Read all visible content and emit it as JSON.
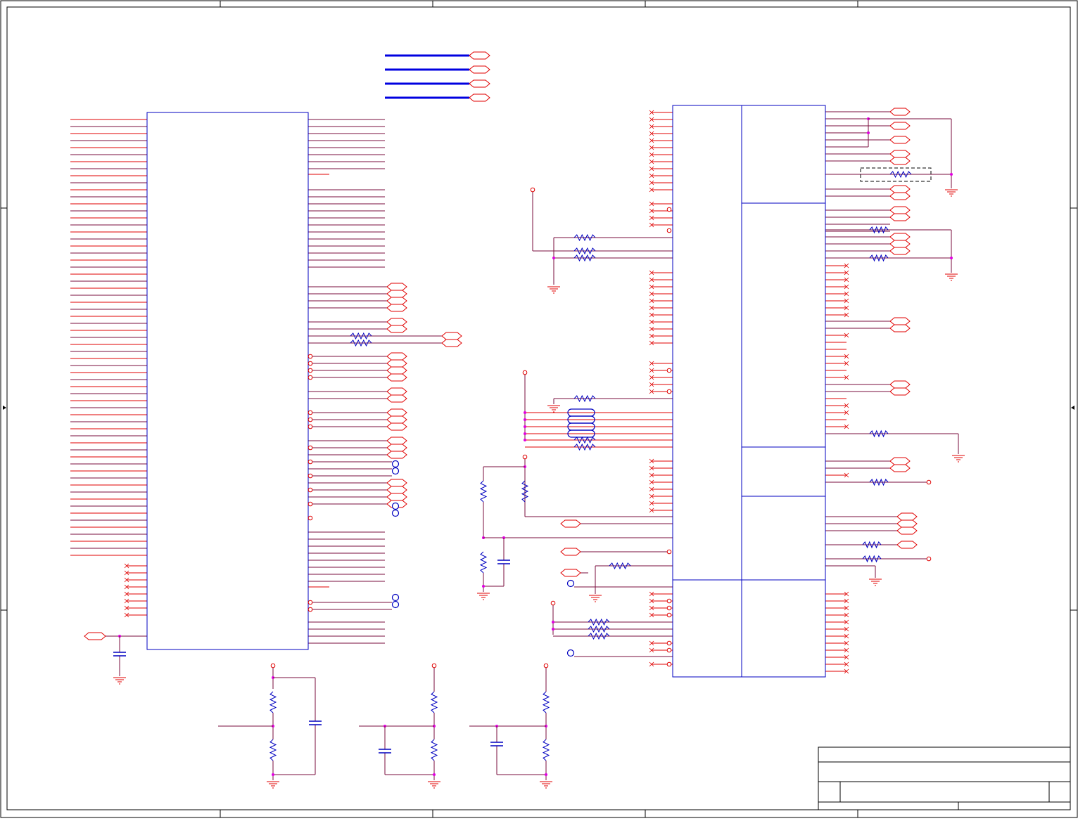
{
  "title_block": {
    "title": "",
    "document_number": "",
    "revision": "",
    "size": "",
    "date": "",
    "sheet": ""
  },
  "colors": {
    "frame": "#000000",
    "wire": "#7a0c3c",
    "pin": "#e00000",
    "symbol": "#0000c0",
    "bus": "#0000e0",
    "junction": "#e000e0"
  },
  "icons": {
    "port": "hexagon-port-icon",
    "ground": "ground-icon",
    "resistor": "resistor-icon",
    "capacitor": "capacitor-icon",
    "no_connect": "no-connect-icon",
    "test_point": "test-point-icon",
    "power": "power-pin-icon"
  },
  "components": [
    {
      "id": "u-main-processor",
      "kind": "ic"
    },
    {
      "id": "u-interface-ic",
      "kind": "ic"
    }
  ]
}
